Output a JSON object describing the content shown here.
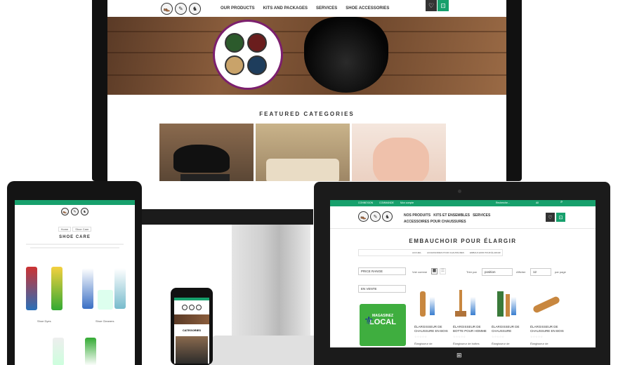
{
  "desktop": {
    "nav": [
      "OUR PRODUCTS",
      "KITS AND PACKAGES",
      "SERVICES",
      "SHOE ACCESSORIES"
    ],
    "featured_title": "FEATURED CATEGORIES"
  },
  "tablet_left": {
    "title": "SHOE CARE",
    "breadcrumb": [
      "Home",
      "Shoe Care"
    ],
    "products": [
      {
        "label": "Shoe Dyes"
      },
      {
        "label": "Shoe Cleaners"
      }
    ]
  },
  "phone": {
    "section": "CATEGORIES"
  },
  "tablet_right": {
    "topbar": [
      "CONNEXION",
      "COMMANDE",
      "Mon compte"
    ],
    "search_placeholder": "Recherche...",
    "search_scope": "All",
    "nav": [
      "NOS PRODUITS",
      "KITS ET ENSEMBLES",
      "SERVICES",
      "ACCESSOIRES POUR CHAUSSURES"
    ],
    "page_title": "EMBAUCHOIR POUR ÉLARGIR",
    "breadcrumb": [
      "ACCUEIL",
      "ACCESSOIRES POUR CHAUSSURES",
      "EMBAUCHOIR POUR ÉLARGIR"
    ],
    "filter1": "PRICE RANGE",
    "filter2": "EN VENTE",
    "view_label": "Voir comme",
    "sort_label": "Trier par",
    "sort_value": "position",
    "show_label": "Afficher",
    "show_value": "12",
    "per_page": "par page",
    "badge_line1": "MAGASINEZ",
    "badge_line2": "LOCAL",
    "products": [
      {
        "name": "ÉLARGISSEUR DE CHAUSSURE EN BOIS",
        "desc": "Élargisseur de"
      },
      {
        "name": "ÉLARGISSEUR DE BOTTE POUR HOMME",
        "desc": "Élargisseur de bottes"
      },
      {
        "name": "ÉLARGISSEUR DE CHAUSSURE",
        "desc": "Élargisseur de"
      },
      {
        "name": "ÉLARGISSEUR DE CHAUSSURE EN BOIS",
        "desc": "Élargisseur de"
      }
    ]
  },
  "colors": {
    "brand_green": "#17a06c",
    "accent_purple": "#7c1f6e"
  }
}
